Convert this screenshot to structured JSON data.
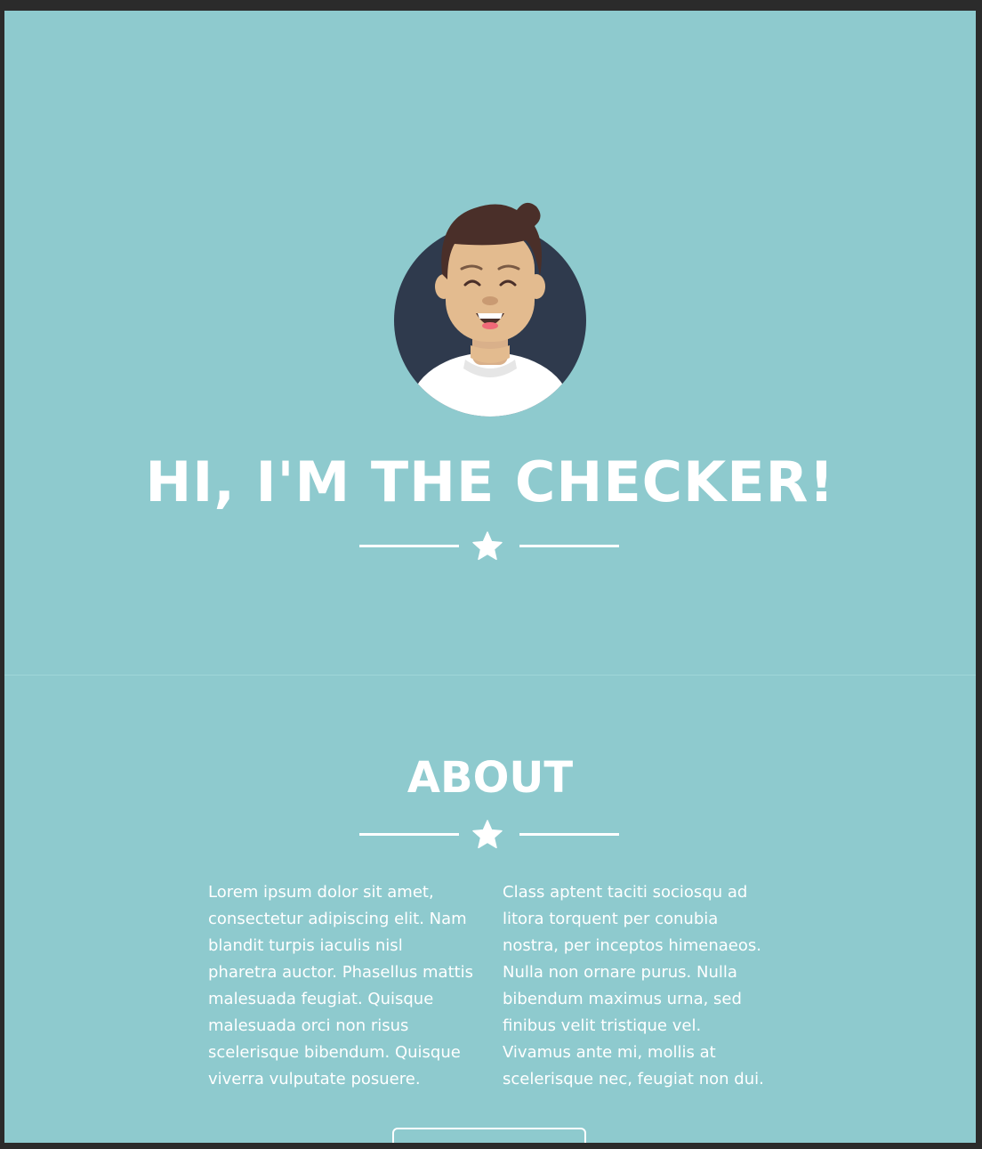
{
  "hero": {
    "title": "HI, I'M THE CHECKER!",
    "avatar_icon": "avatar-illustration"
  },
  "about": {
    "title": "ABOUT",
    "left_text": "Lorem ipsum dolor sit amet, consectetur adipiscing elit. Nam blandit turpis iaculis nisl pharetra auctor. Phasellus mattis malesuada feugiat. Quisque malesuada orci non risus scelerisque bibendum. Quisque viverra vulputate posuere.",
    "right_text": "Class aptent taciti sociosqu ad litora torquent per conubia nostra, per inceptos himenaeos. Nulla non ornare purus. Nulla bibendum maximus urna, sed finibus velit tristique vel. Vivamus ante mi, mollis at scelerisque nec, feugiat non dui.",
    "button_label": ""
  },
  "colors": {
    "background": "#8ecace",
    "text": "#ffffff",
    "avatar_circle": "#2f3a4d",
    "frame": "#2b2b2b"
  },
  "icons": {
    "divider": "star-icon"
  }
}
